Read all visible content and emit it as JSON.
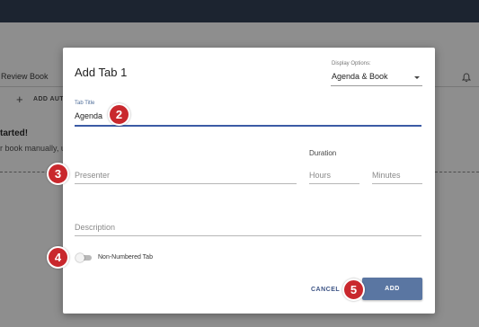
{
  "background": {
    "book_title": "Review Book",
    "add_button": "ADD AUT",
    "heading": "tarted!",
    "description": "r book manually, u"
  },
  "modal": {
    "title": "Add Tab 1",
    "display_options": {
      "label": "Display Options:",
      "value": "Agenda & Book"
    },
    "tab_title": {
      "label": "Tab Title",
      "value": "Agenda"
    },
    "duration_label": "Duration",
    "fields": {
      "presenter": "Presenter",
      "hours": "Hours",
      "minutes": "Minutes",
      "description": "Description"
    },
    "toggle_label": "Non-Numbered Tab",
    "toggle_on": false,
    "cancel_label": "CANCEL",
    "add_label": "ADD"
  },
  "callouts": [
    "2",
    "3",
    "4",
    "5"
  ],
  "colors": {
    "accent": "#3b5ba5",
    "add_button": "#5a76a2",
    "callout": "#c9282d",
    "topbar": "#1c2430"
  }
}
